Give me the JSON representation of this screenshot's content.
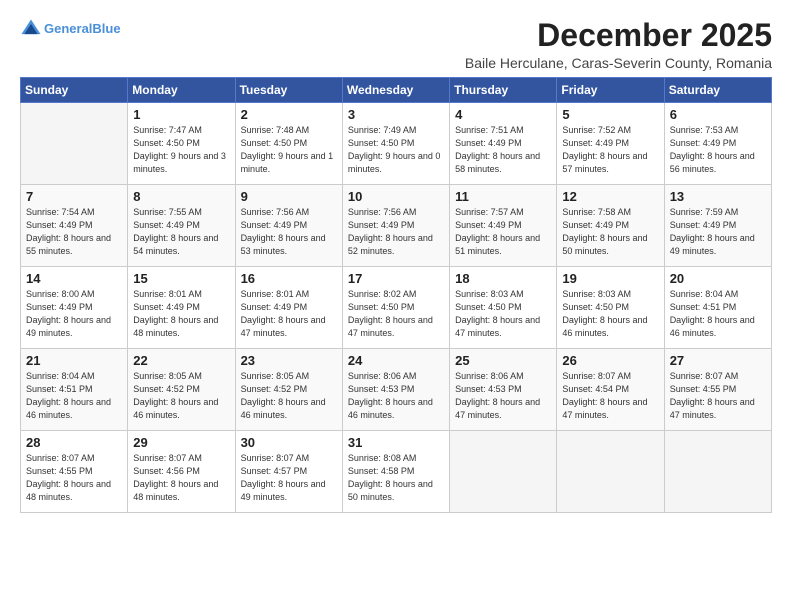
{
  "logo": {
    "line1": "General",
    "line2": "Blue"
  },
  "title": "December 2025",
  "location": "Baile Herculane, Caras-Severin County, Romania",
  "weekdays": [
    "Sunday",
    "Monday",
    "Tuesday",
    "Wednesday",
    "Thursday",
    "Friday",
    "Saturday"
  ],
  "weeks": [
    [
      {
        "day": "",
        "sunrise": "",
        "sunset": "",
        "daylight": ""
      },
      {
        "day": "1",
        "sunrise": "Sunrise: 7:47 AM",
        "sunset": "Sunset: 4:50 PM",
        "daylight": "Daylight: 9 hours and 3 minutes."
      },
      {
        "day": "2",
        "sunrise": "Sunrise: 7:48 AM",
        "sunset": "Sunset: 4:50 PM",
        "daylight": "Daylight: 9 hours and 1 minute."
      },
      {
        "day": "3",
        "sunrise": "Sunrise: 7:49 AM",
        "sunset": "Sunset: 4:50 PM",
        "daylight": "Daylight: 9 hours and 0 minutes."
      },
      {
        "day": "4",
        "sunrise": "Sunrise: 7:51 AM",
        "sunset": "Sunset: 4:49 PM",
        "daylight": "Daylight: 8 hours and 58 minutes."
      },
      {
        "day": "5",
        "sunrise": "Sunrise: 7:52 AM",
        "sunset": "Sunset: 4:49 PM",
        "daylight": "Daylight: 8 hours and 57 minutes."
      },
      {
        "day": "6",
        "sunrise": "Sunrise: 7:53 AM",
        "sunset": "Sunset: 4:49 PM",
        "daylight": "Daylight: 8 hours and 56 minutes."
      }
    ],
    [
      {
        "day": "7",
        "sunrise": "Sunrise: 7:54 AM",
        "sunset": "Sunset: 4:49 PM",
        "daylight": "Daylight: 8 hours and 55 minutes."
      },
      {
        "day": "8",
        "sunrise": "Sunrise: 7:55 AM",
        "sunset": "Sunset: 4:49 PM",
        "daylight": "Daylight: 8 hours and 54 minutes."
      },
      {
        "day": "9",
        "sunrise": "Sunrise: 7:56 AM",
        "sunset": "Sunset: 4:49 PM",
        "daylight": "Daylight: 8 hours and 53 minutes."
      },
      {
        "day": "10",
        "sunrise": "Sunrise: 7:56 AM",
        "sunset": "Sunset: 4:49 PM",
        "daylight": "Daylight: 8 hours and 52 minutes."
      },
      {
        "day": "11",
        "sunrise": "Sunrise: 7:57 AM",
        "sunset": "Sunset: 4:49 PM",
        "daylight": "Daylight: 8 hours and 51 minutes."
      },
      {
        "day": "12",
        "sunrise": "Sunrise: 7:58 AM",
        "sunset": "Sunset: 4:49 PM",
        "daylight": "Daylight: 8 hours and 50 minutes."
      },
      {
        "day": "13",
        "sunrise": "Sunrise: 7:59 AM",
        "sunset": "Sunset: 4:49 PM",
        "daylight": "Daylight: 8 hours and 49 minutes."
      }
    ],
    [
      {
        "day": "14",
        "sunrise": "Sunrise: 8:00 AM",
        "sunset": "Sunset: 4:49 PM",
        "daylight": "Daylight: 8 hours and 49 minutes."
      },
      {
        "day": "15",
        "sunrise": "Sunrise: 8:01 AM",
        "sunset": "Sunset: 4:49 PM",
        "daylight": "Daylight: 8 hours and 48 minutes."
      },
      {
        "day": "16",
        "sunrise": "Sunrise: 8:01 AM",
        "sunset": "Sunset: 4:49 PM",
        "daylight": "Daylight: 8 hours and 47 minutes."
      },
      {
        "day": "17",
        "sunrise": "Sunrise: 8:02 AM",
        "sunset": "Sunset: 4:50 PM",
        "daylight": "Daylight: 8 hours and 47 minutes."
      },
      {
        "day": "18",
        "sunrise": "Sunrise: 8:03 AM",
        "sunset": "Sunset: 4:50 PM",
        "daylight": "Daylight: 8 hours and 47 minutes."
      },
      {
        "day": "19",
        "sunrise": "Sunrise: 8:03 AM",
        "sunset": "Sunset: 4:50 PM",
        "daylight": "Daylight: 8 hours and 46 minutes."
      },
      {
        "day": "20",
        "sunrise": "Sunrise: 8:04 AM",
        "sunset": "Sunset: 4:51 PM",
        "daylight": "Daylight: 8 hours and 46 minutes."
      }
    ],
    [
      {
        "day": "21",
        "sunrise": "Sunrise: 8:04 AM",
        "sunset": "Sunset: 4:51 PM",
        "daylight": "Daylight: 8 hours and 46 minutes."
      },
      {
        "day": "22",
        "sunrise": "Sunrise: 8:05 AM",
        "sunset": "Sunset: 4:52 PM",
        "daylight": "Daylight: 8 hours and 46 minutes."
      },
      {
        "day": "23",
        "sunrise": "Sunrise: 8:05 AM",
        "sunset": "Sunset: 4:52 PM",
        "daylight": "Daylight: 8 hours and 46 minutes."
      },
      {
        "day": "24",
        "sunrise": "Sunrise: 8:06 AM",
        "sunset": "Sunset: 4:53 PM",
        "daylight": "Daylight: 8 hours and 46 minutes."
      },
      {
        "day": "25",
        "sunrise": "Sunrise: 8:06 AM",
        "sunset": "Sunset: 4:53 PM",
        "daylight": "Daylight: 8 hours and 47 minutes."
      },
      {
        "day": "26",
        "sunrise": "Sunrise: 8:07 AM",
        "sunset": "Sunset: 4:54 PM",
        "daylight": "Daylight: 8 hours and 47 minutes."
      },
      {
        "day": "27",
        "sunrise": "Sunrise: 8:07 AM",
        "sunset": "Sunset: 4:55 PM",
        "daylight": "Daylight: 8 hours and 47 minutes."
      }
    ],
    [
      {
        "day": "28",
        "sunrise": "Sunrise: 8:07 AM",
        "sunset": "Sunset: 4:55 PM",
        "daylight": "Daylight: 8 hours and 48 minutes."
      },
      {
        "day": "29",
        "sunrise": "Sunrise: 8:07 AM",
        "sunset": "Sunset: 4:56 PM",
        "daylight": "Daylight: 8 hours and 48 minutes."
      },
      {
        "day": "30",
        "sunrise": "Sunrise: 8:07 AM",
        "sunset": "Sunset: 4:57 PM",
        "daylight": "Daylight: 8 hours and 49 minutes."
      },
      {
        "day": "31",
        "sunrise": "Sunrise: 8:08 AM",
        "sunset": "Sunset: 4:58 PM",
        "daylight": "Daylight: 8 hours and 50 minutes."
      },
      {
        "day": "",
        "sunrise": "",
        "sunset": "",
        "daylight": ""
      },
      {
        "day": "",
        "sunrise": "",
        "sunset": "",
        "daylight": ""
      },
      {
        "day": "",
        "sunrise": "",
        "sunset": "",
        "daylight": ""
      }
    ]
  ]
}
